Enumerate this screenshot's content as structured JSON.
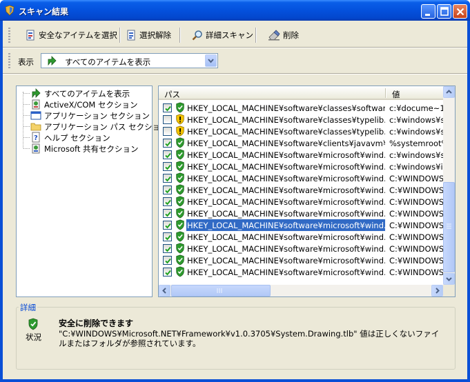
{
  "window": {
    "title": "スキャン結果"
  },
  "toolbar": {
    "select_safe": "安全なアイテムを選択",
    "deselect": "選択解除",
    "detail_scan": "詳細スキャン",
    "delete": "削除"
  },
  "view": {
    "label": "表示",
    "selected": "すべてのアイテムを表示"
  },
  "tree": [
    {
      "label": "すべてのアイテムを表示",
      "icon": "green-arrow-icon"
    },
    {
      "label": "ActiveX/COM セクション",
      "icon": "activex-icon"
    },
    {
      "label": "アプリケーション セクション",
      "icon": "window-icon"
    },
    {
      "label": "アプリケーション パス セクション",
      "icon": "folder-icon"
    },
    {
      "label": "ヘルプ セクション",
      "icon": "help-icon"
    },
    {
      "label": "Microsoft 共有セクション",
      "icon": "shared-icon"
    }
  ],
  "list": {
    "col_path": "パス",
    "col_value": "値",
    "rows": [
      {
        "checked": true,
        "status": "safe",
        "path": "HKEY_LOCAL_MACHINE¥software¥classes¥softwar...",
        "value": "c:¥docume~1¥"
      },
      {
        "checked": false,
        "status": "warning",
        "path": "HKEY_LOCAL_MACHINE¥software¥classes¥typelib...",
        "value": "c:¥windows¥sy"
      },
      {
        "checked": false,
        "status": "warning",
        "path": "HKEY_LOCAL_MACHINE¥software¥classes¥typelib...",
        "value": "c:¥windows¥sy"
      },
      {
        "checked": true,
        "status": "safe",
        "path": "HKEY_LOCAL_MACHINE¥software¥clients¥javavm¥...",
        "value": "%systemroot%"
      },
      {
        "checked": true,
        "status": "safe",
        "path": "HKEY_LOCAL_MACHINE¥software¥microsoft¥wind...",
        "value": "c:¥windows¥sy"
      },
      {
        "checked": true,
        "status": "safe",
        "path": "HKEY_LOCAL_MACHINE¥software¥microsoft¥wind...",
        "value": "c:¥windows¥in"
      },
      {
        "checked": true,
        "status": "safe",
        "path": "HKEY_LOCAL_MACHINE¥software¥microsoft¥wind...",
        "value": "C:¥WINDOWS"
      },
      {
        "checked": true,
        "status": "safe",
        "path": "HKEY_LOCAL_MACHINE¥software¥microsoft¥wind...",
        "value": "C:¥WINDOWS"
      },
      {
        "checked": true,
        "status": "safe",
        "path": "HKEY_LOCAL_MACHINE¥software¥microsoft¥wind...",
        "value": "C:¥WINDOWS"
      },
      {
        "checked": true,
        "status": "safe",
        "path": "HKEY_LOCAL_MACHINE¥software¥microsoft¥wind...",
        "value": "C:¥WINDOWS"
      },
      {
        "checked": true,
        "status": "safe",
        "path": "HKEY_LOCAL_MACHINE¥software¥microsoft¥wind...",
        "value": "C:¥WINDOWS",
        "selected": true
      },
      {
        "checked": true,
        "status": "safe",
        "path": "HKEY_LOCAL_MACHINE¥software¥microsoft¥wind...",
        "value": "C:¥WINDOWS"
      },
      {
        "checked": true,
        "status": "safe",
        "path": "HKEY_LOCAL_MACHINE¥software¥microsoft¥wind...",
        "value": "C:¥WINDOWS"
      },
      {
        "checked": true,
        "status": "safe",
        "path": "HKEY_LOCAL_MACHINE¥software¥microsoft¥wind...",
        "value": "C:¥WINDOWS"
      },
      {
        "checked": true,
        "status": "safe",
        "path": "HKEY_LOCAL_MACHINE¥software¥microsoft¥wind...",
        "value": "C:¥WINDOWS"
      }
    ]
  },
  "details": {
    "legend": "詳細",
    "status_label": "状況",
    "title": "安全に削除できます",
    "description": "\"C:¥WINDOWS¥Microsoft.NET¥Framework¥v1.0.3705¥System.Drawing.tlb\" 値は正しくないファイルまたはフォルダが参照されています。"
  },
  "colors": {
    "titlebar": "#0451dd",
    "selection": "#316ac5",
    "safe_shield": "#2e9a2e",
    "warning_shield": "#f2c200",
    "legend_text": "#0046d5"
  }
}
